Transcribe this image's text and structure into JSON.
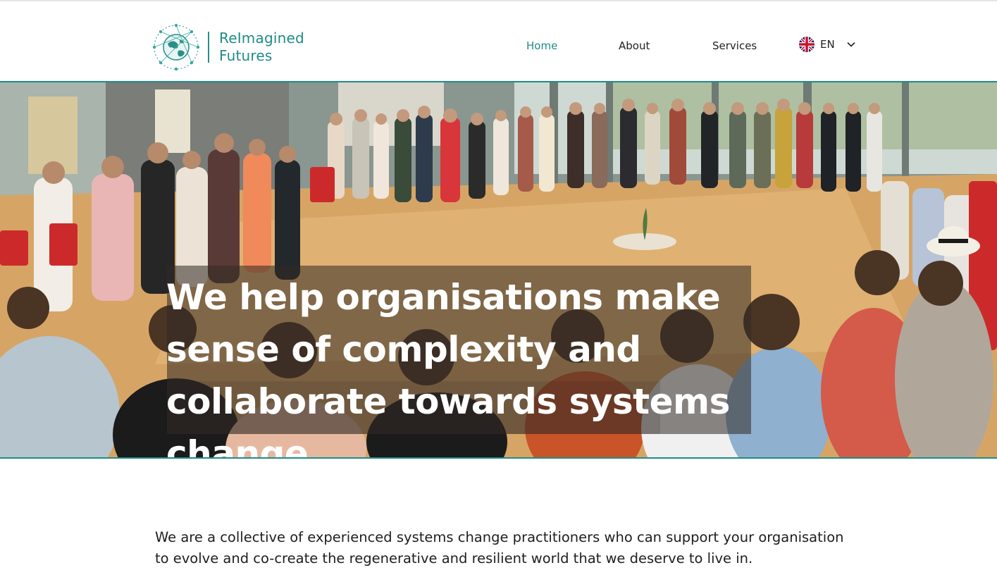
{
  "brand": {
    "name_line1": "ReImagined",
    "name_line2": "Futures",
    "accent_color": "#1f8c86"
  },
  "nav": {
    "items": [
      {
        "label": "Home",
        "active": true
      },
      {
        "label": "About",
        "active": false
      },
      {
        "label": "Services",
        "active": false
      }
    ]
  },
  "language": {
    "flag_icon": "uk-flag-icon",
    "label": "EN",
    "dropdown_icon": "chevron-down-icon"
  },
  "hero": {
    "headline": "We help organisations make sense of complexity and collaborate towards systems change",
    "image_subject": "circle-of-people-photo"
  },
  "intro": {
    "text": "We are a collective of experienced systems change practitioners who can support your organisation to evolve and co-create the regenerative and resilient world that we deserve to live in."
  }
}
